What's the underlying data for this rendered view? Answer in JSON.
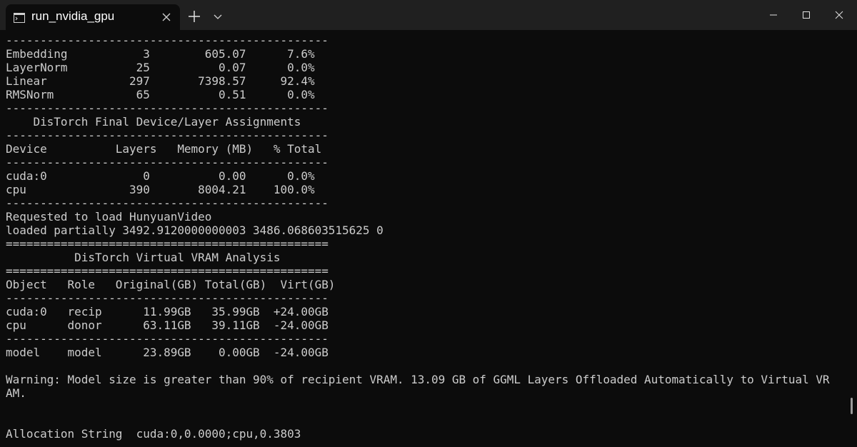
{
  "window": {
    "tab_title": "run_nvidia_gpu",
    "icons": {
      "tab": "terminal-icon",
      "tab_close": "close-icon",
      "new_tab": "plus-icon",
      "dropdown": "chevron-down-icon",
      "minimize": "minimize-icon",
      "maximize": "maximize-icon",
      "close": "close-icon"
    }
  },
  "colors": {
    "background": "#0c0c0c",
    "titlebar": "#202020",
    "text": "#cccccc"
  },
  "terminal": {
    "lines": [
      "-----------------------------------------------",
      "Embedding           3        605.07      7.6%",
      "LayerNorm          25          0.07      0.0%",
      "Linear            297       7398.57     92.4%",
      "RMSNorm            65          0.51      0.0%",
      "-----------------------------------------------",
      "    DisTorch Final Device/Layer Assignments",
      "-----------------------------------------------",
      "Device          Layers   Memory (MB)   % Total",
      "-----------------------------------------------",
      "cuda:0              0          0.00      0.0%",
      "cpu               390       8004.21    100.0%",
      "-----------------------------------------------",
      "Requested to load HunyuanVideo",
      "loaded partially 3492.9120000000003 3486.068603515625 0",
      "===============================================",
      "          DisTorch Virtual VRAM Analysis",
      "===============================================",
      "Object   Role   Original(GB) Total(GB)  Virt(GB)",
      "-----------------------------------------------",
      "cuda:0   recip      11.99GB   35.99GB  +24.00GB",
      "cpu      donor      63.11GB   39.11GB  -24.00GB",
      "-----------------------------------------------",
      "model    model      23.89GB    0.00GB  -24.00GB",
      "",
      "Warning: Model size is greater than 90% of recipient VRAM. 13.09 GB of GGML Layers Offloaded Automatically to Virtual VR",
      "AM.",
      "",
      "",
      "Allocation String  cuda:0,0.0000;cpu,0.3803"
    ]
  }
}
